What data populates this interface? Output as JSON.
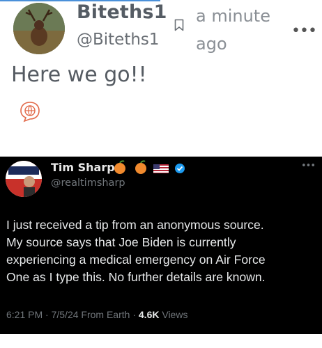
{
  "post": {
    "display_name": "Biteths1",
    "handle": "@Biteths1",
    "timestamp": "a minute ago",
    "more_label": "•••",
    "text": "Here we go!!"
  },
  "icons": {
    "bookmark": "bookmark-icon",
    "translate": "globe-speech-icon",
    "verified": "verified-badge-icon"
  },
  "embedded_tweet": {
    "name": "Tim Sharp",
    "emojis": [
      "peach",
      "peach",
      "us-flag",
      "verified-badge"
    ],
    "handle": "@realtimsharp",
    "more_label": "•••",
    "body": "I just received a tip from an anonymous source.\nMy source says that Joe Biden is currently\nexperiencing a medical emergency on Air Force\nOne as I type this.   No further details are known.",
    "time": "6:21 PM",
    "date": "7/5/24",
    "location": "From Earth",
    "views_count": "4.6K",
    "views_label": "Views"
  }
}
